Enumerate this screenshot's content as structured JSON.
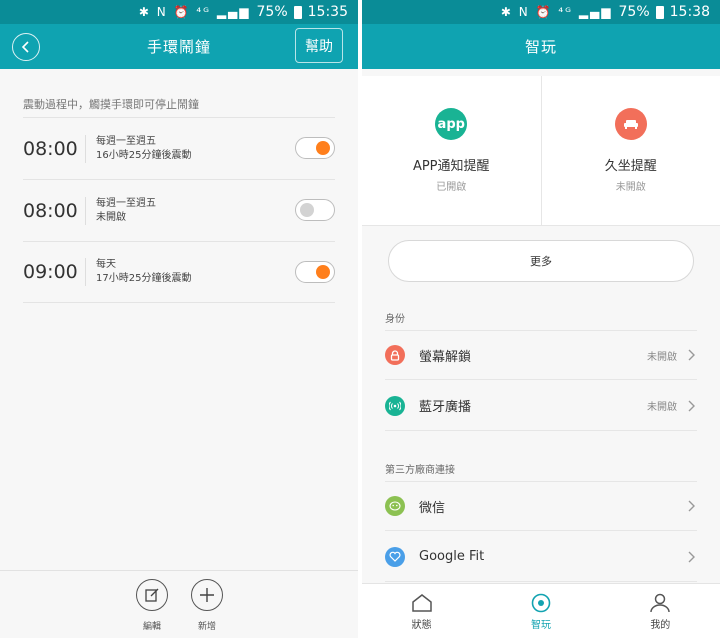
{
  "left": {
    "status": {
      "time": "15:35",
      "battery": "75%"
    },
    "appbar": {
      "title": "手環鬧鐘",
      "help_label": "幫助"
    },
    "hint": "震動過程中，觸摸手環即可停止鬧鐘",
    "alarms": [
      {
        "time": "08:00",
        "line1": "每週一至週五",
        "line2": "16小時25分鐘後震動",
        "enabled": true
      },
      {
        "time": "08:00",
        "line1": "每週一至週五",
        "line2": "未開啟",
        "enabled": false
      },
      {
        "time": "09:00",
        "line1": "每天",
        "line2": "17小時25分鐘後震動",
        "enabled": true
      }
    ],
    "bottom": {
      "edit_label": "編輯",
      "add_label": "新增"
    }
  },
  "right": {
    "status": {
      "time": "15:38",
      "battery": "75%"
    },
    "appbar": {
      "title": "智玩"
    },
    "cards": [
      {
        "icon": "app-notification-icon",
        "icon_text": "app",
        "color": "#19b394",
        "label": "APP通知提醒",
        "status": "已開啟"
      },
      {
        "icon": "sofa-icon",
        "color": "#f26f5a",
        "label": "久坐提醒",
        "status": "未開啟"
      }
    ],
    "more_label": "更多",
    "section_identity": "身份",
    "identity_rows": [
      {
        "icon": "lock-icon",
        "color": "#f26f5a",
        "label": "螢幕解鎖",
        "status": "未開啟"
      },
      {
        "icon": "broadcast-icon",
        "color": "#19b394",
        "label": "藍牙廣播",
        "status": "未開啟"
      }
    ],
    "section_third": "第三方廠商連接",
    "third_rows": [
      {
        "icon": "wechat-icon",
        "color": "#8cc152",
        "label": "微信"
      },
      {
        "icon": "heart-icon",
        "color": "#4a9fe8",
        "label": "Google Fit"
      }
    ],
    "tabs": [
      {
        "label": "狀態",
        "icon": "home-icon",
        "active": false
      },
      {
        "label": "智玩",
        "icon": "smart-icon",
        "active": true
      },
      {
        "label": "我的",
        "icon": "profile-icon",
        "active": false
      }
    ],
    "colors": {
      "accent": "#13a3b1",
      "appbar": "#0fa3b1",
      "statusbar": "#0a8c97"
    }
  }
}
